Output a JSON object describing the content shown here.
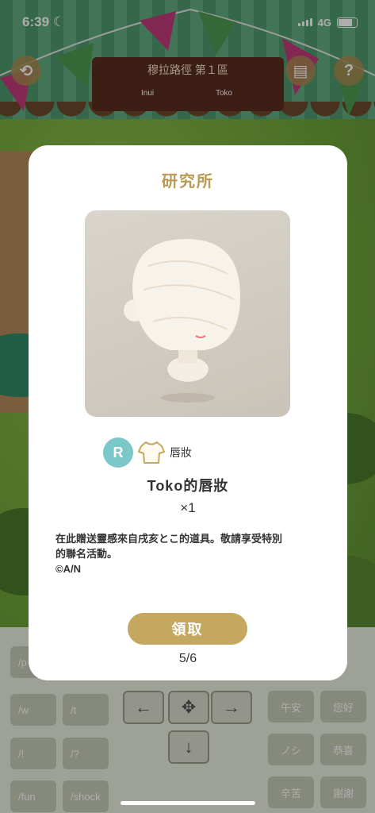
{
  "status_bar": {
    "time": "6:39",
    "network": "4G",
    "moon_icon": "moon-icon"
  },
  "top_bar": {
    "location_title": "穆拉路徑 第１區",
    "sign_left_text": "Inui",
    "sign_right_text": "Toko",
    "help_label": "?"
  },
  "modal": {
    "title": "研究所",
    "rarity": "R",
    "category": "唇妝",
    "item_name": "Toko的唇妝",
    "quantity": "×1",
    "description_line1": "在此贈送靈感來自戌亥とこ的道具。敬請享受特別",
    "description_line2": "的聯名活動。",
    "copyright": "©A/N",
    "claim_button": "領取",
    "pager": "5/6",
    "accent_color": "#c5a85f",
    "rarity_color": "#7cc7c9"
  },
  "controls": {
    "chat_commands": [
      "/p",
      "/w",
      "/t",
      "/!",
      "/?",
      "/fun",
      "/shock"
    ],
    "quick_phrases": [
      "午安",
      "您好",
      "ノシ",
      "恭喜",
      "辛苦",
      "謝謝"
    ],
    "dpad": [
      "left-arrow-icon",
      "move-icon",
      "right-arrow-icon",
      "down-arrow-icon"
    ]
  }
}
